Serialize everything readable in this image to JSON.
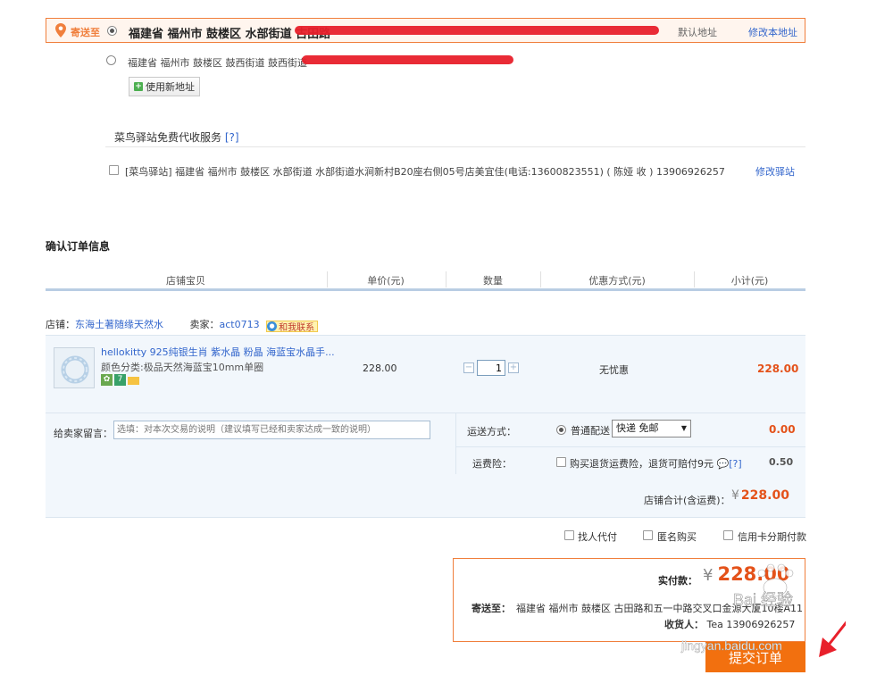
{
  "address": {
    "send_to_label": "寄送至",
    "selected_text": "福建省 福州市 鼓楼区 水部街道 古田路",
    "default_label": "默认地址",
    "edit_label": "修改本地址",
    "second_text": "福建省 福州市 鼓楼区 鼓西街道 鼓西街道",
    "new_address_label": "使用新地址"
  },
  "cainiao": {
    "title": "菜鸟驿站免费代收服务",
    "help": "[?]",
    "station_text": "[菜鸟驿站] 福建省 福州市 鼓楼区 水部街道 水部街道水涧新村B20座右侧05号店美宜佳(电话:13600823551) ( 陈娅 收 ) 13906926257",
    "edit_label": "修改驿站"
  },
  "order": {
    "title": "确认订单信息",
    "headers": [
      "店铺宝贝",
      "单价(元)",
      "数量",
      "优惠方式(元)",
      "小计(元)"
    ],
    "shop_prefix": "店铺：",
    "shop_name": "东海土著随缘天然水",
    "seller_prefix": "卖家：",
    "seller_name": "act0713",
    "contact_label": "和我联系",
    "item": {
      "title": "hellokitty 925纯银生肖 紫水晶 粉晶 海蓝宝水晶手...",
      "sku": "颜色分类:极品天然海蓝宝10mm单圈",
      "price": "228.00",
      "quantity": "1",
      "discount": "无忧惠",
      "subtotal": "228.00"
    },
    "message_label": "给卖家留言：",
    "message_placeholder": "选填：对本次交易的说明（建议填写已经和卖家达成一致的说明）",
    "shipping_label": "运送方式：",
    "shipping_option": "普通配送",
    "shipping_select": "快递 免邮",
    "shipping_fee": "0.00",
    "insurance_label": "运费险：",
    "insurance_text": "购买退货运费险，退货可赔付9元",
    "insurance_help": "[?]",
    "insurance_fee": "0.50",
    "shop_total_label": "店铺合计(含运费)：",
    "currency": "¥",
    "shop_total": "228.00"
  },
  "options": {
    "proxy_pay": "找人代付",
    "anonymous": "匿名购买",
    "installment": "信用卡分期付款"
  },
  "summary": {
    "pay_label": "实付款：",
    "currency": "¥",
    "pay_amount": "228.00",
    "send_to_label": "寄送至：",
    "send_to_text": "福建省 福州市 鼓楼区 古田路和五一中路交叉口金源大厦10楼A11",
    "receiver_label": "收货人：",
    "receiver_text": "Tea 13906926257"
  },
  "submit_label": "提交订单",
  "watermark": {
    "brand": "Bai 经验",
    "url": "jingyan.baidu.com"
  }
}
